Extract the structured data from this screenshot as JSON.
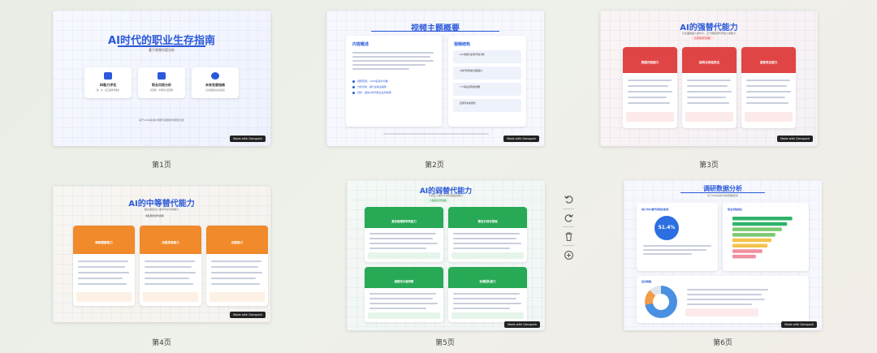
{
  "slides": [
    {
      "label": "第1页",
      "title": "AI时代的职业生存指南",
      "subtitle": "基于视频内容分析",
      "features": [
        {
          "title": "AI能力评估",
          "desc": "强、中、弱三级替代能力"
        },
        {
          "title": "职业风险分析",
          "desc": "高风险、中风险与低风险"
        },
        {
          "title": "未来发展指南",
          "desc": "应对策略与适应指南"
        }
      ],
      "footer": "基于1000名用户调研与视频学术研究分析"
    },
    {
      "label": "第2页",
      "title": "视频主题概要",
      "left_heading": "内容概述",
      "right_heading": "视频结构",
      "points": [
        "调研范围：1000名用户问卷",
        "分析对象：各行业职业趋势",
        "目标：提供AI时代职业生存指南"
      ],
      "structure": [
        "AI人类能力的替代性分析",
        "AI替代风险的全面探讨",
        "个人职业风险的测量",
        "应用与未来展望"
      ]
    },
    {
      "label": "第3页",
      "title": "AI的强替代能力",
      "subtitle": "已全面超越人类水平，正大规模替代传统人类能力",
      "badge": "高风险替代领域",
      "cards": [
        "数据归纳能力",
        "结构化表格表达",
        "语音表达能力"
      ]
    },
    {
      "label": "第4页",
      "title": "AI的中等替代能力",
      "subtitle": "超过或接近人类平均水平的能力",
      "badge": "中度风险替代领域",
      "cards": [
        "情感理解能力",
        "深度思维能力",
        "创意能力"
      ]
    },
    {
      "label": "第5页",
      "title": "AI的弱替代能力",
      "subtitle": "与真正人类水平尚有差距的能力",
      "badge": "人类相对优势领域",
      "cards": [
        "复杂推理和审判能力",
        "算法计划与预测",
        "道德与价值判断",
        "协调团队能力"
      ]
    },
    {
      "label": "第6页",
      "title": "调研数据分析",
      "subtitle": "基于1000名用户的调研数据结果",
      "stat_value": "51.4%",
      "stat_title": "用户对AI替代风险的担忧",
      "chart_title": "职业风险排名",
      "pie_title": "应对策略",
      "chart_data": {
        "type": "bar",
        "values": [
          92,
          84,
          76,
          66,
          60,
          54,
          46,
          36
        ]
      }
    }
  ],
  "toolbar": {
    "undo": "undo-icon",
    "redo": "redo-icon",
    "delete": "trash-icon",
    "add": "add-icon"
  },
  "colors": {
    "blue": "#2b59d9",
    "red": "#e04545",
    "orange": "#f08a2a",
    "green": "#28a956"
  },
  "watermark": "Made with Genspark"
}
